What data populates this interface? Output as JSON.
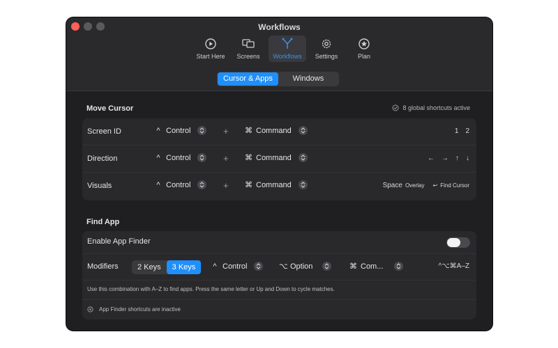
{
  "window": {
    "title": "Workflows"
  },
  "toolbar": {
    "items": [
      {
        "label": "Start Here",
        "icon": "play-circle-icon",
        "active": false
      },
      {
        "label": "Screens",
        "icon": "screens-icon",
        "active": false
      },
      {
        "label": "Workflows",
        "icon": "workflow-icon",
        "active": true
      },
      {
        "label": "Settings",
        "icon": "gear-icon",
        "active": false
      },
      {
        "label": "Plan",
        "icon": "star-icon",
        "active": false
      }
    ]
  },
  "tabs": {
    "cursor_apps": "Cursor & Apps",
    "windows": "Windows",
    "active": "cursor_apps"
  },
  "move_cursor": {
    "title": "Move Cursor",
    "status": "8 global shortcuts active",
    "rows": [
      {
        "label": "Screen ID",
        "mod1": "Control",
        "mod1_glyph": "^",
        "plus": "+",
        "mod2": "Command",
        "mod2_glyph": "⌘",
        "right": [
          "1",
          "2"
        ]
      },
      {
        "label": "Direction",
        "mod1": "Control",
        "mod1_glyph": "^",
        "plus": "+",
        "mod2": "Command",
        "mod2_glyph": "⌘",
        "right": [
          "←",
          "→",
          "↑",
          "↓"
        ]
      },
      {
        "label": "Visuals",
        "mod1": "Control",
        "mod1_glyph": "^",
        "plus": "+",
        "mod2": "Command",
        "mod2_glyph": "⌘",
        "right_key": "Space",
        "right_key_label": "Overlay",
        "right_action_glyph": "↩",
        "right_action": "Find Cursor"
      }
    ]
  },
  "find_app": {
    "title": "Find App",
    "enable_label": "Enable App Finder",
    "enabled": false,
    "modifiers_label": "Modifiers",
    "keys_2": "2 Keys",
    "keys_3": "3 Keys",
    "keys_active": "3 Keys",
    "mod1_glyph": "^",
    "mod1": "Control",
    "mod2_glyph": "⌥",
    "mod2": "Option",
    "mod3_glyph": "⌘",
    "mod3": "Com...",
    "combo": "^⌥⌘A–Z",
    "note": "Use this combination with A–Z to find apps. Press the same letter or Up and Down to cycle matches.",
    "inactive": "App Finder shortcuts are inactive"
  },
  "colors": {
    "accent": "#1f8ffb",
    "close": "#ff5f57",
    "background": "#1f1f21"
  }
}
